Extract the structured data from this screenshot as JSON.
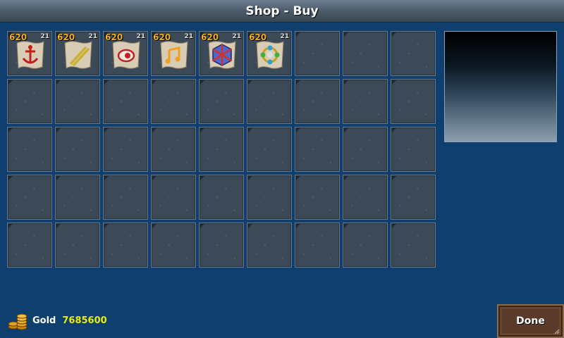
{
  "header": {
    "title": "Shop - Buy"
  },
  "items": [
    {
      "price": "620",
      "stock": "21",
      "icon": "anchor-rune-icon",
      "color": "#c0201a"
    },
    {
      "price": "620",
      "stock": "21",
      "icon": "sticks-icon",
      "color": "#c8b030"
    },
    {
      "price": "620",
      "stock": "21",
      "icon": "eye-icon",
      "color": "#c0202a"
    },
    {
      "price": "620",
      "stock": "21",
      "icon": "music-note-icon",
      "color": "#f0a020"
    },
    {
      "price": "620",
      "stock": "21",
      "icon": "gem-cube-icon",
      "color": "#d03030"
    },
    {
      "price": "620",
      "stock": "21",
      "icon": "ring-orb-icon",
      "color": "#30a0d0"
    }
  ],
  "footer": {
    "gold_label": "Gold",
    "gold_value": "7685600",
    "done_label": "Done"
  },
  "colors": {
    "background": "#0e3f6e",
    "price": "#f0b020",
    "gold_value": "#e8f000",
    "button": "#5a3a28"
  }
}
